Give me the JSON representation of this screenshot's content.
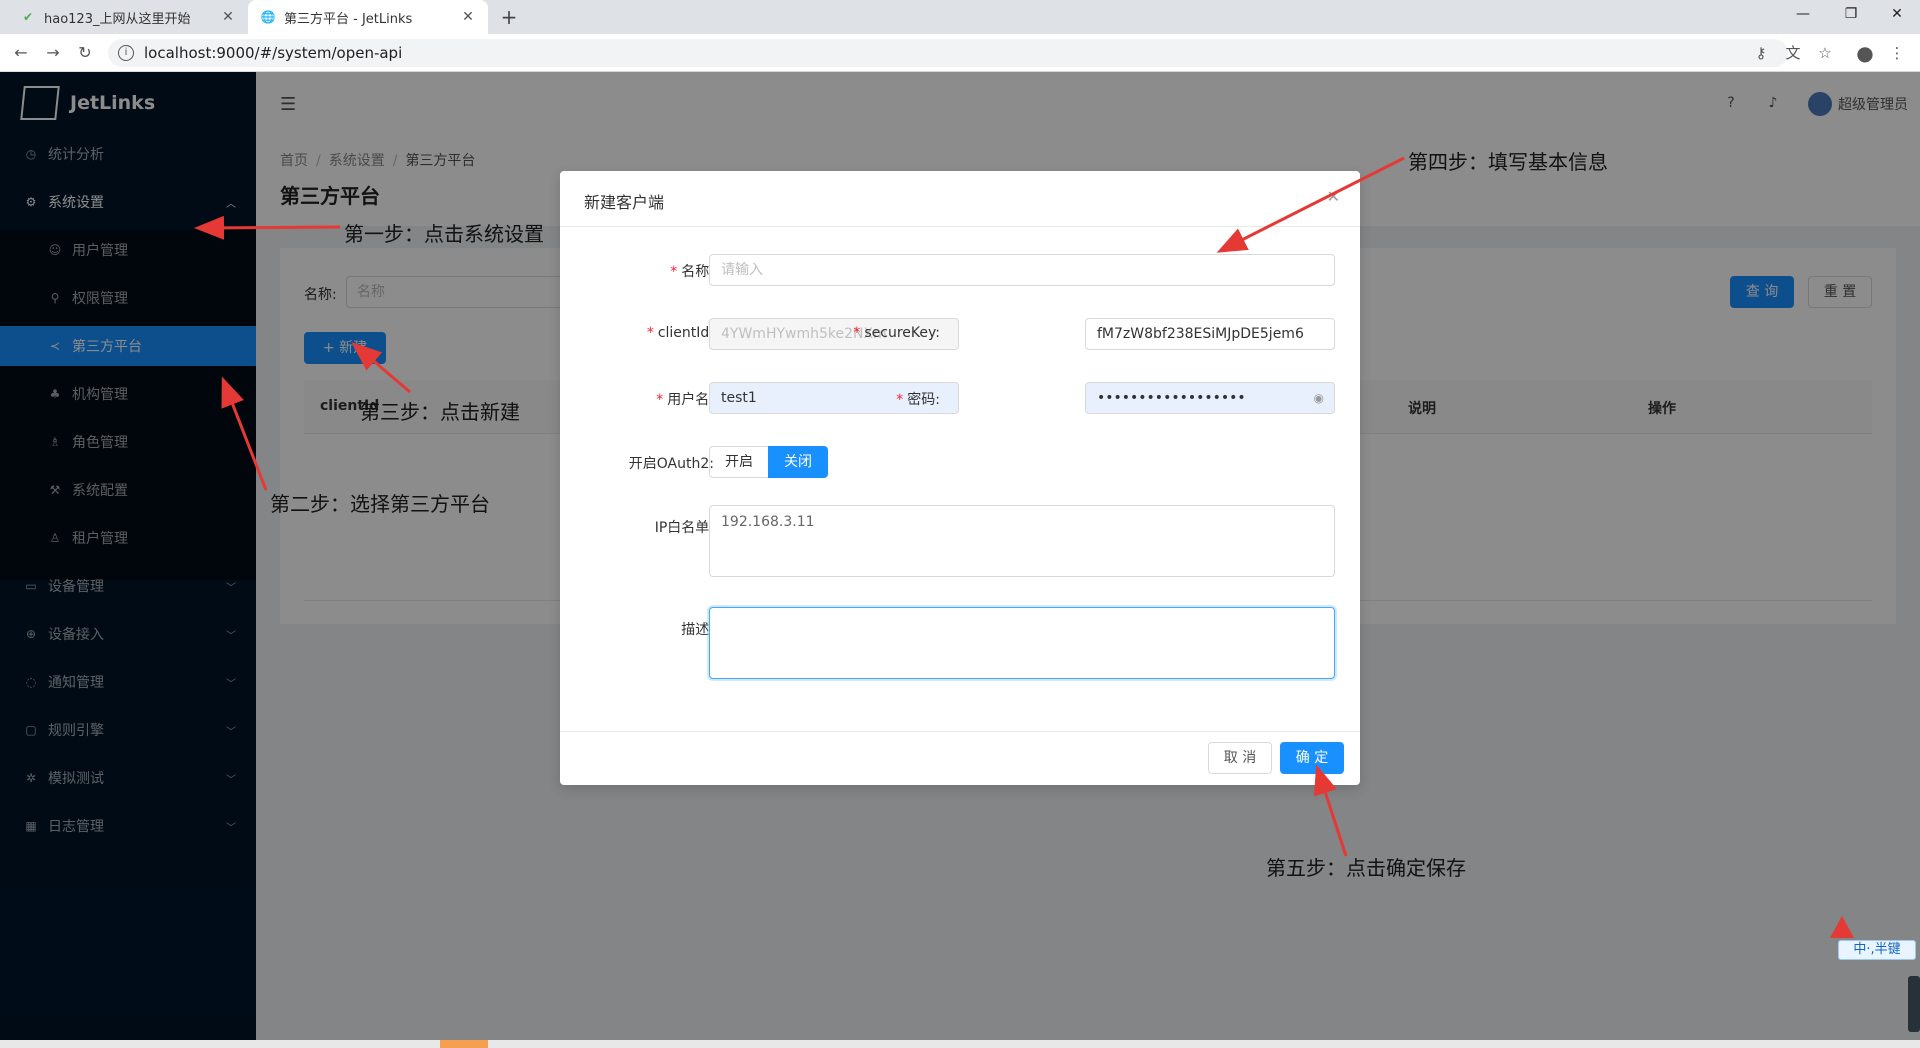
{
  "browser": {
    "tabs": [
      {
        "title": "hao123_上网从这里开始",
        "favicon": "hao123-icon",
        "active": false
      },
      {
        "title": "第三方平台 - JetLinks",
        "favicon": "globe-icon",
        "active": true
      }
    ],
    "url": "localhost:9000/#/system/open-api"
  },
  "app": {
    "brand": "JetLinks",
    "header": {
      "username": "超级管理员"
    },
    "sidebar": {
      "items": [
        {
          "label": "统计分析",
          "icon": "dashboard-icon"
        },
        {
          "label": "系统设置",
          "icon": "gear-icon",
          "expanded": true
        },
        {
          "label": "用户管理",
          "icon": "user-icon",
          "sub": true
        },
        {
          "label": "权限管理",
          "icon": "key-icon",
          "sub": true
        },
        {
          "label": "第三方平台",
          "icon": "share-icon",
          "sub": true,
          "active": true
        },
        {
          "label": "机构管理",
          "icon": "org-icon",
          "sub": true
        },
        {
          "label": "角色管理",
          "icon": "role-icon",
          "sub": true
        },
        {
          "label": "系统配置",
          "icon": "tool-icon",
          "sub": true
        },
        {
          "label": "租户管理",
          "icon": "tenant-icon",
          "sub": true
        },
        {
          "label": "设备管理",
          "icon": "device-icon"
        },
        {
          "label": "设备接入",
          "icon": "plug-icon"
        },
        {
          "label": "通知管理",
          "icon": "message-icon"
        },
        {
          "label": "规则引擎",
          "icon": "rule-icon"
        },
        {
          "label": "模拟测试",
          "icon": "bug-icon"
        },
        {
          "label": "日志管理",
          "icon": "calendar-icon"
        }
      ]
    },
    "breadcrumb": [
      "首页",
      "系统设置",
      "第三方平台"
    ],
    "page_title": "第三方平台",
    "search": {
      "label": "名称:",
      "placeholder": "名称"
    },
    "buttons": {
      "query": "查 询",
      "reset": "重 置",
      "new": "+ 新建"
    },
    "table": {
      "columns": [
        "clientId",
        "说明",
        "操作"
      ]
    }
  },
  "modal": {
    "title": "新建客户端",
    "fields": {
      "name": {
        "label": "名称:",
        "placeholder": "请输入",
        "value": ""
      },
      "clientId": {
        "label": "clientId:",
        "value": "4YWmHYwmh5ke2NXm"
      },
      "secureKey": {
        "label": "secureKey:",
        "value": "fM7zW8bf238ESiMJpDE5jem6"
      },
      "username": {
        "label": "用户名:",
        "value": "test1"
      },
      "password": {
        "label": "密码:",
        "value": "••••••••••••••••••"
      },
      "oauth2": {
        "label": "开启OAuth2:",
        "options": [
          "开启",
          "关闭"
        ],
        "selected": "关闭"
      },
      "ip_whitelist": {
        "label": "IP白名单:",
        "value": "192.168.3.11"
      },
      "description": {
        "label": "描述:",
        "value": ""
      }
    },
    "buttons": {
      "cancel": "取 消",
      "ok": "确 定"
    }
  },
  "annotations": {
    "step1": "第一步：点击系统设置",
    "step2": "第二步：选择第三方平台",
    "step3": "第三步：点击新建",
    "step4": "第四步：填写基本信息",
    "step5": "第五步：点击确定保存"
  },
  "colors": {
    "primary": "#1890ff",
    "sidebar": "#001529",
    "annotation_arrow": "#e53935"
  },
  "ime": {
    "label": "中·,半键"
  }
}
